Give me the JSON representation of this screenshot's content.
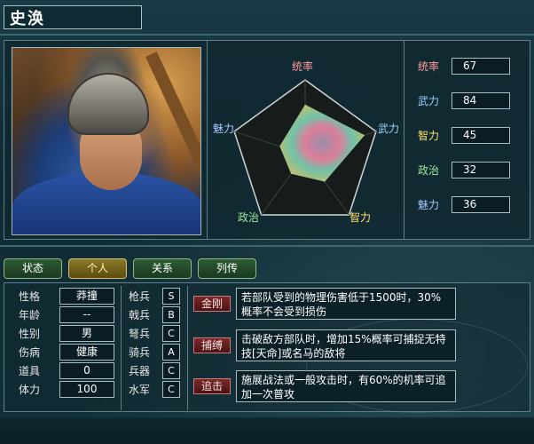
{
  "character": {
    "name": "史涣"
  },
  "radar": {
    "labels": {
      "command": "统率",
      "war": "武力",
      "intel": "智力",
      "politics": "政治",
      "charm": "魅力"
    },
    "values": {
      "command": 67,
      "war": 84,
      "intel": 45,
      "politics": 32,
      "charm": 36
    },
    "max": 100,
    "colors": {
      "command": "#ff9aa0",
      "war": "#8fd4ff",
      "intel": "#ffe36a",
      "politics": "#9ee79a",
      "charm": "#a7c9ff"
    }
  },
  "stats": [
    {
      "name": "统率",
      "value": "67",
      "color": "#ff9aa0"
    },
    {
      "name": "武力",
      "value": "84",
      "color": "#8fd4ff"
    },
    {
      "name": "智力",
      "value": "45",
      "color": "#ffe36a"
    },
    {
      "name": "政治",
      "value": "32",
      "color": "#9ee79a"
    },
    {
      "name": "魅力",
      "value": "36",
      "color": "#a7c9ff"
    }
  ],
  "tabs": [
    {
      "label": "状态",
      "active": false
    },
    {
      "label": "个人",
      "active": true
    },
    {
      "label": "关系",
      "active": false
    },
    {
      "label": "列传",
      "active": false
    }
  ],
  "info": [
    {
      "key": "性格",
      "value": "莽撞"
    },
    {
      "key": "年龄",
      "value": "--"
    },
    {
      "key": "性别",
      "value": "男"
    },
    {
      "key": "伤病",
      "value": "健康"
    },
    {
      "key": "道具",
      "value": "0"
    },
    {
      "key": "体力",
      "value": "100"
    }
  ],
  "troops": [
    {
      "key": "枪兵",
      "value": "S"
    },
    {
      "key": "戟兵",
      "value": "B"
    },
    {
      "key": "弩兵",
      "value": "C"
    },
    {
      "key": "骑兵",
      "value": "A"
    },
    {
      "key": "兵器",
      "value": "C"
    },
    {
      "key": "水军",
      "value": "C"
    }
  ],
  "skills": [
    {
      "name": "金刚",
      "desc": "若部队受到的物理伤害低于1500时，30%概率不会受到损伤"
    },
    {
      "name": "捕缚",
      "desc": "击破敌方部队时，增加15%概率可捕捉无特技[天命]或名马的敌将"
    },
    {
      "name": "追击",
      "desc": "施展战法或一般攻击时，有60%的机率可追加一次普攻"
    }
  ]
}
